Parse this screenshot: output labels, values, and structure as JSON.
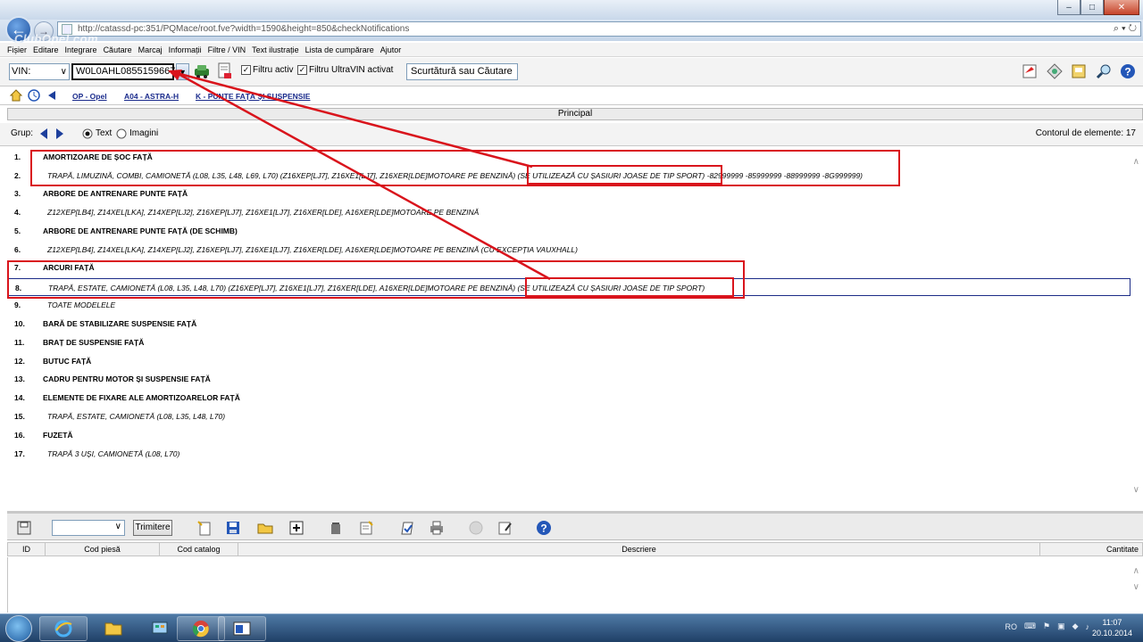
{
  "browser": {
    "url": "http://catassd-pc:351/PQMace/root.fve?width=1590&height=850&checkNotifications",
    "url_tools": "⌕ ▾ ↻",
    "watermark": "ClubOpel.com",
    "window_buttons": [
      "–",
      "□",
      "✕"
    ]
  },
  "menu": [
    "Fișier",
    "Editare",
    "Integrare",
    "Căutare",
    "Marcaj",
    "Informații",
    "Filtre / VIN",
    "Text ilustrație",
    "Lista de cumpărare",
    "Ajutor"
  ],
  "toolbar": {
    "vin_type": "VIN:",
    "vin_value": "W0L0AHL0855159667",
    "filter_active_label": "Filtru activ",
    "filter_active_checked": true,
    "filter_ultravin_label": "Filtru UltraVIN activat",
    "filter_ultravin_checked": true,
    "search_placeholder": "Scurtătură sau Căutare"
  },
  "breadcrumb": [
    "OP - Opel",
    "A04 - ASTRA-H",
    "K - PUNTE FAȚĂ ȘI SUSPENSIE"
  ],
  "panel_title": "Principal",
  "group": {
    "label": "Grup:",
    "view_text": "Text",
    "view_images": "Imagini",
    "selected_view": "Text",
    "element_count": "Contorul de elemente: 17"
  },
  "items": [
    {
      "num": "1.",
      "text": "AMORTIZOARE DE ȘOC FAȚĂ",
      "kind": "header"
    },
    {
      "num": "2.",
      "text": "TRAPĂ, LIMUZINĂ, COMBI, CAMIONETĂ (L08, L35, L48, L69, L70) (Z16XEP[LJ7], Z16XE1[LJ7], Z16XER[LDE]MOTOARE PE BENZINĂ) (SE UTILIZEAZĂ CU ȘASIURI JOASE DE TIP SPORT) -82999999 -85999999 -88999999 -8G999999)",
      "kind": "sub"
    },
    {
      "num": "3.",
      "text": "ARBORE DE ANTRENARE PUNTE FAȚĂ",
      "kind": "header"
    },
    {
      "num": "4.",
      "text": "Z12XEP[LB4], Z14XEL[LKA], Z14XEP[LJ2], Z16XEP[LJ7], Z16XE1[LJ7], Z16XER[LDE], A16XER[LDE]MOTOARE PE BENZINĂ",
      "kind": "sub"
    },
    {
      "num": "5.",
      "text": "ARBORE DE ANTRENARE PUNTE FAȚĂ (DE SCHIMB)",
      "kind": "header"
    },
    {
      "num": "6.",
      "text": "Z12XEP[LB4], Z14XEL[LKA], Z14XEP[LJ2], Z16XEP[LJ7], Z16XE1[LJ7], Z16XER[LDE], A16XER[LDE]MOTOARE PE BENZINĂ (CU EXCEPȚIA VAUXHALL)",
      "kind": "sub"
    },
    {
      "num": "7.",
      "text": "ARCURI FAȚĂ",
      "kind": "header"
    },
    {
      "num": "8.",
      "text": "TRAPĂ, ESTATE, CAMIONETĂ (L08, L35, L48, L70) (Z16XEP[LJ7], Z16XE1[LJ7], Z16XER[LDE], A16XER[LDE]MOTOARE PE BENZINĂ) (SE UTILIZEAZĂ CU ȘASIURI JOASE DE TIP SPORT)",
      "kind": "sub",
      "selected": true
    },
    {
      "num": "9.",
      "text": "TOATE MODELELE",
      "kind": "sub"
    },
    {
      "num": "10.",
      "text": "BARĂ DE STABILIZARE SUSPENSIE FAȚĂ",
      "kind": "header"
    },
    {
      "num": "11.",
      "text": "BRAȚ DE SUSPENSIE FAȚĂ",
      "kind": "header"
    },
    {
      "num": "12.",
      "text": "BUTUC FAȚĂ",
      "kind": "header"
    },
    {
      "num": "13.",
      "text": "CADRU PENTRU MOTOR ȘI SUSPENSIE FAȚĂ",
      "kind": "header"
    },
    {
      "num": "14.",
      "text": "ELEMENTE DE FIXARE ALE AMORTIZOARELOR FAȚĂ",
      "kind": "header"
    },
    {
      "num": "15.",
      "text": "TRAPĂ, ESTATE, CAMIONETĂ (L08, L35, L48, L70)",
      "kind": "sub"
    },
    {
      "num": "16.",
      "text": "FUZETĂ",
      "kind": "header"
    },
    {
      "num": "17.",
      "text": "TRAPĂ 3 UȘI, CAMIONETĂ (L08, L70)",
      "kind": "sub"
    }
  ],
  "bottom_toolbar": {
    "send_label": "Trimitere"
  },
  "table_headers": [
    "ID",
    "Cod piesă",
    "Cod catalog",
    "Descriere",
    "Cantitate"
  ],
  "taskbar": {
    "language": "RO",
    "time": "11:07",
    "date": "20.10.2014"
  },
  "annotation_color": "#d9141c"
}
